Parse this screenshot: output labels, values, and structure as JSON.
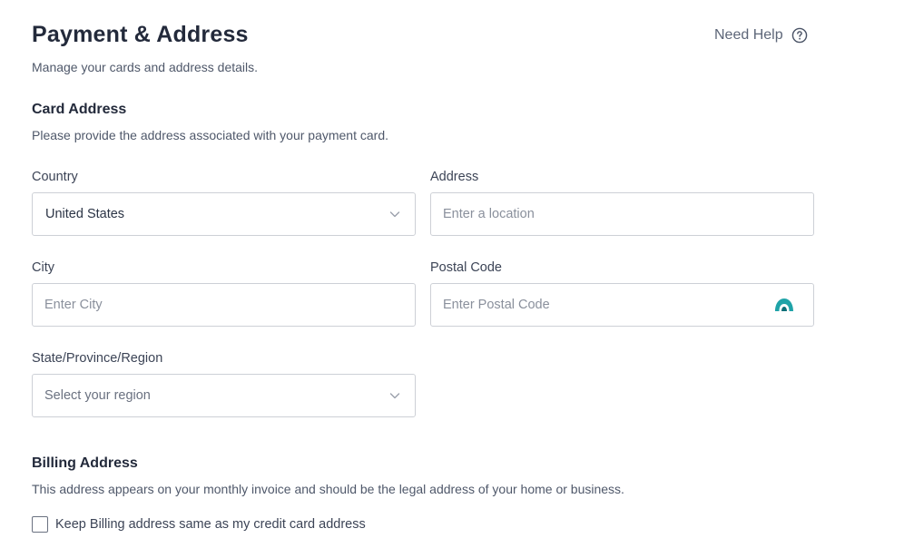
{
  "header": {
    "title": "Payment & Address",
    "subtitle": "Manage your cards and address details.",
    "help_label": "Need Help"
  },
  "card_address": {
    "title": "Card Address",
    "description": "Please provide the address associated with your payment card.",
    "country": {
      "label": "Country",
      "value": "United States"
    },
    "address": {
      "label": "Address",
      "placeholder": "Enter a location"
    },
    "city": {
      "label": "City",
      "placeholder": "Enter City"
    },
    "postal_code": {
      "label": "Postal Code",
      "placeholder": "Enter Postal Code"
    },
    "region": {
      "label": "State/Province/Region",
      "placeholder": "Select your region"
    }
  },
  "billing_address": {
    "title": "Billing Address",
    "description": "This address appears on your monthly invoice and should be the legal address of your home or business.",
    "same_as_card_label": "Keep Billing address same as my credit card address",
    "same_as_card_checked": false
  },
  "colors": {
    "text_dark": "#232a3b",
    "border": "#cdd0d6",
    "accent_teal": "#1fa3a8"
  },
  "icons": {
    "help": "question-circle-icon",
    "dropdown": "chevron-down-icon",
    "postal_extension": "teal-arch-icon"
  }
}
